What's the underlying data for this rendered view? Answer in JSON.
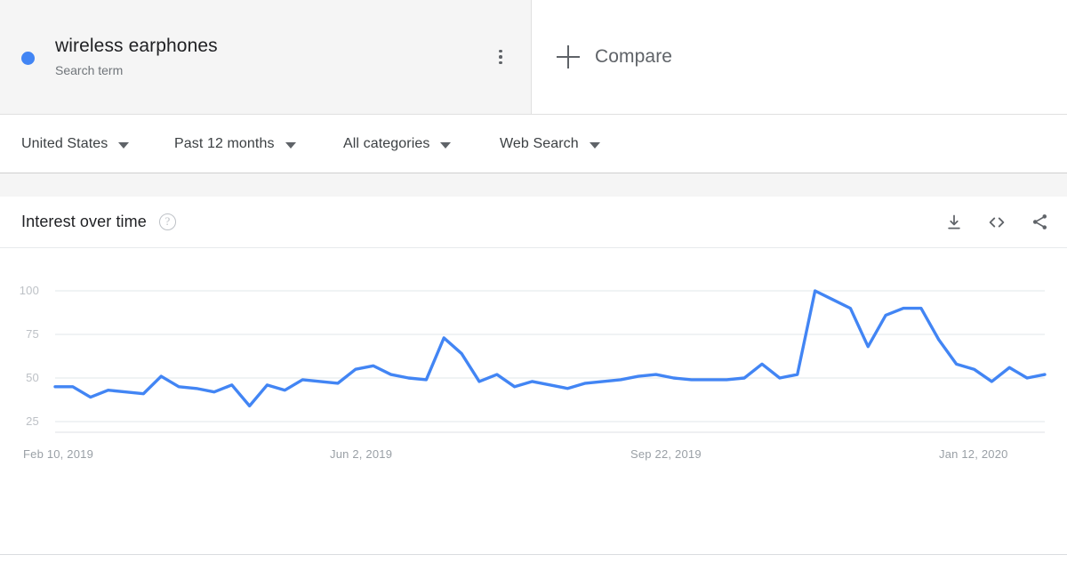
{
  "terms": {
    "primary": {
      "label": "wireless earphones",
      "type_label": "Search term",
      "color": "#4285F4",
      "menu_icon": "kebab-menu-icon"
    },
    "compare": {
      "label": "Compare",
      "icon": "plus-icon"
    }
  },
  "filters": [
    {
      "label": "United States",
      "name": "location"
    },
    {
      "label": "Past 12 months",
      "name": "time-range"
    },
    {
      "label": "All categories",
      "name": "category"
    },
    {
      "label": "Web Search",
      "name": "search-type"
    }
  ],
  "chart_card": {
    "title": "Interest over time",
    "help_icon": "question-mark-icon",
    "actions": [
      {
        "name": "download-icon",
        "label": "Download"
      },
      {
        "name": "embed-code-icon",
        "label": "Embed"
      },
      {
        "name": "share-icon",
        "label": "Share"
      }
    ]
  },
  "chart_data": {
    "type": "line",
    "title": "Interest over time",
    "xlabel": "",
    "ylabel": "",
    "ylim": [
      0,
      100
    ],
    "yticks": [
      100,
      75,
      50,
      25
    ],
    "grid": true,
    "legend": false,
    "line_color": "#4285F4",
    "xticks": [
      "Feb 10, 2019",
      "Jun 2, 2019",
      "Sep 22, 2019",
      "Jan 12, 2020"
    ],
    "xtick_indices": [
      0,
      16,
      32,
      48
    ],
    "series": [
      {
        "name": "wireless earphones",
        "color": "#4285F4",
        "values": [
          45,
          45,
          39,
          43,
          42,
          41,
          51,
          45,
          44,
          42,
          46,
          34,
          46,
          43,
          49,
          48,
          47,
          55,
          57,
          52,
          50,
          49,
          73,
          64,
          48,
          52,
          45,
          48,
          46,
          44,
          47,
          48,
          49,
          51,
          52,
          50,
          49,
          49,
          49,
          50,
          58,
          50,
          52,
          100,
          95,
          90,
          68,
          86,
          90,
          90,
          72,
          58,
          55,
          48,
          56,
          50,
          52
        ]
      }
    ]
  }
}
